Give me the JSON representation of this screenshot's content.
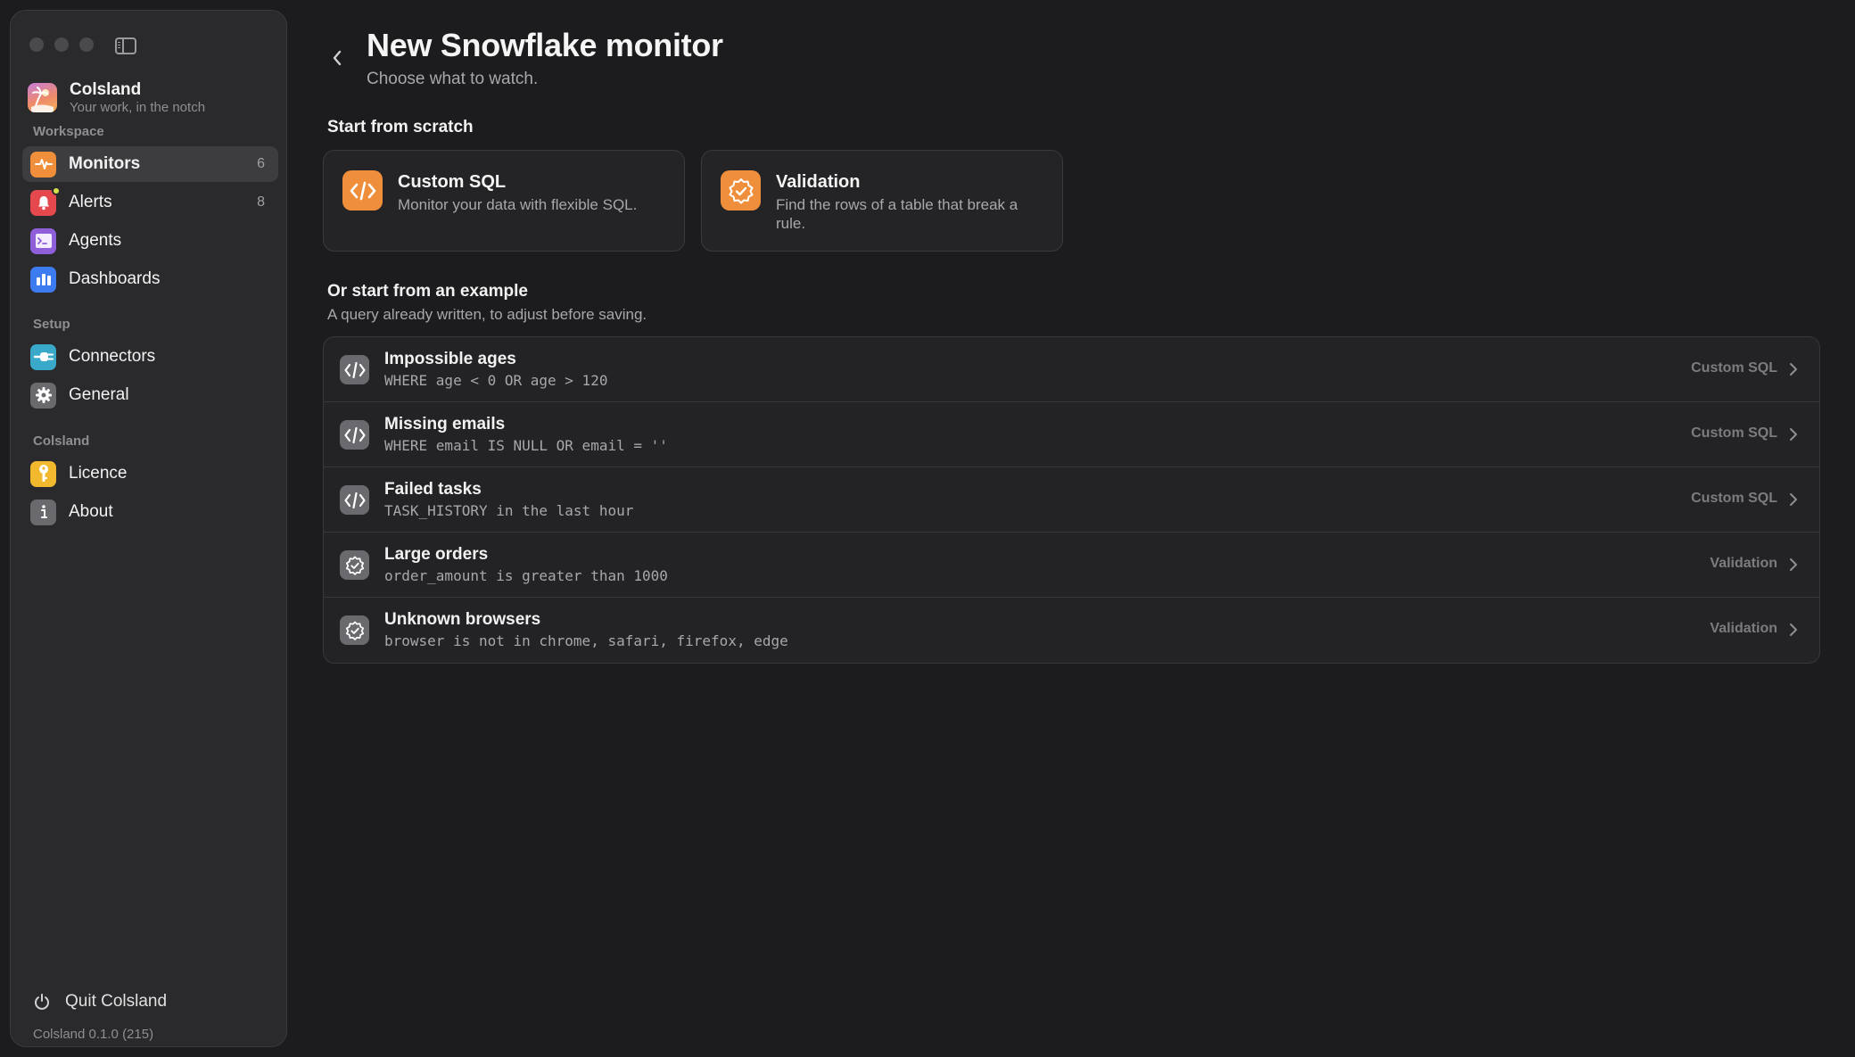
{
  "app": {
    "name": "Colsland",
    "tagline": "Your work, in the notch",
    "version": "Colsland 0.1.0 (215)"
  },
  "sidebar": {
    "sections": {
      "workspace": "Workspace",
      "setup": "Setup",
      "colsland": "Colsland"
    },
    "items": {
      "monitors": {
        "label": "Monitors",
        "count": "6",
        "icon": "waveform-icon",
        "color": "#ef8f3c"
      },
      "alerts": {
        "label": "Alerts",
        "count": "8",
        "icon": "bell-icon",
        "color": "#e5484d"
      },
      "agents": {
        "label": "Agents",
        "icon": "terminal-icon",
        "color": "#8e5fd9"
      },
      "dashboards": {
        "label": "Dashboards",
        "icon": "bar-chart-icon",
        "color": "#3d7bf0"
      },
      "connectors": {
        "label": "Connectors",
        "icon": "plug-icon",
        "color": "#39a8c9"
      },
      "general": {
        "label": "General",
        "icon": "gear-icon",
        "color": "#6a6a6e"
      },
      "licence": {
        "label": "Licence",
        "icon": "key-icon",
        "color": "#f2b92e"
      },
      "about": {
        "label": "About",
        "icon": "info-icon",
        "color": "#6a6a6e"
      }
    },
    "quit_label": "Quit Colsland"
  },
  "main": {
    "title": "New Snowflake monitor",
    "subtitle": "Choose what to watch.",
    "scratch_heading": "Start from scratch",
    "cards": [
      {
        "title": "Custom SQL",
        "desc": "Monitor your data with flexible SQL.",
        "icon": "code-icon"
      },
      {
        "title": "Validation",
        "desc": "Find the rows of a table that break a rule.",
        "icon": "badge-check-icon"
      }
    ],
    "example_heading": "Or start from an example",
    "example_subheading": "A query already written, to adjust before saving.",
    "examples": [
      {
        "title": "Impossible ages",
        "code": "WHERE age < 0 OR age > 120",
        "kind": "Custom SQL",
        "icon": "code-icon"
      },
      {
        "title": "Missing emails",
        "code": "WHERE email IS NULL OR email = ''",
        "kind": "Custom SQL",
        "icon": "code-icon"
      },
      {
        "title": "Failed tasks",
        "code": "TASK_HISTORY in the last hour",
        "kind": "Custom SQL",
        "icon": "code-icon"
      },
      {
        "title": "Large orders",
        "code": "order_amount is greater than 1000",
        "kind": "Validation",
        "icon": "badge-check-icon"
      },
      {
        "title": "Unknown browsers",
        "code": "browser is not in chrome, safari, firefox, edge",
        "kind": "Validation",
        "icon": "badge-check-icon"
      }
    ]
  }
}
